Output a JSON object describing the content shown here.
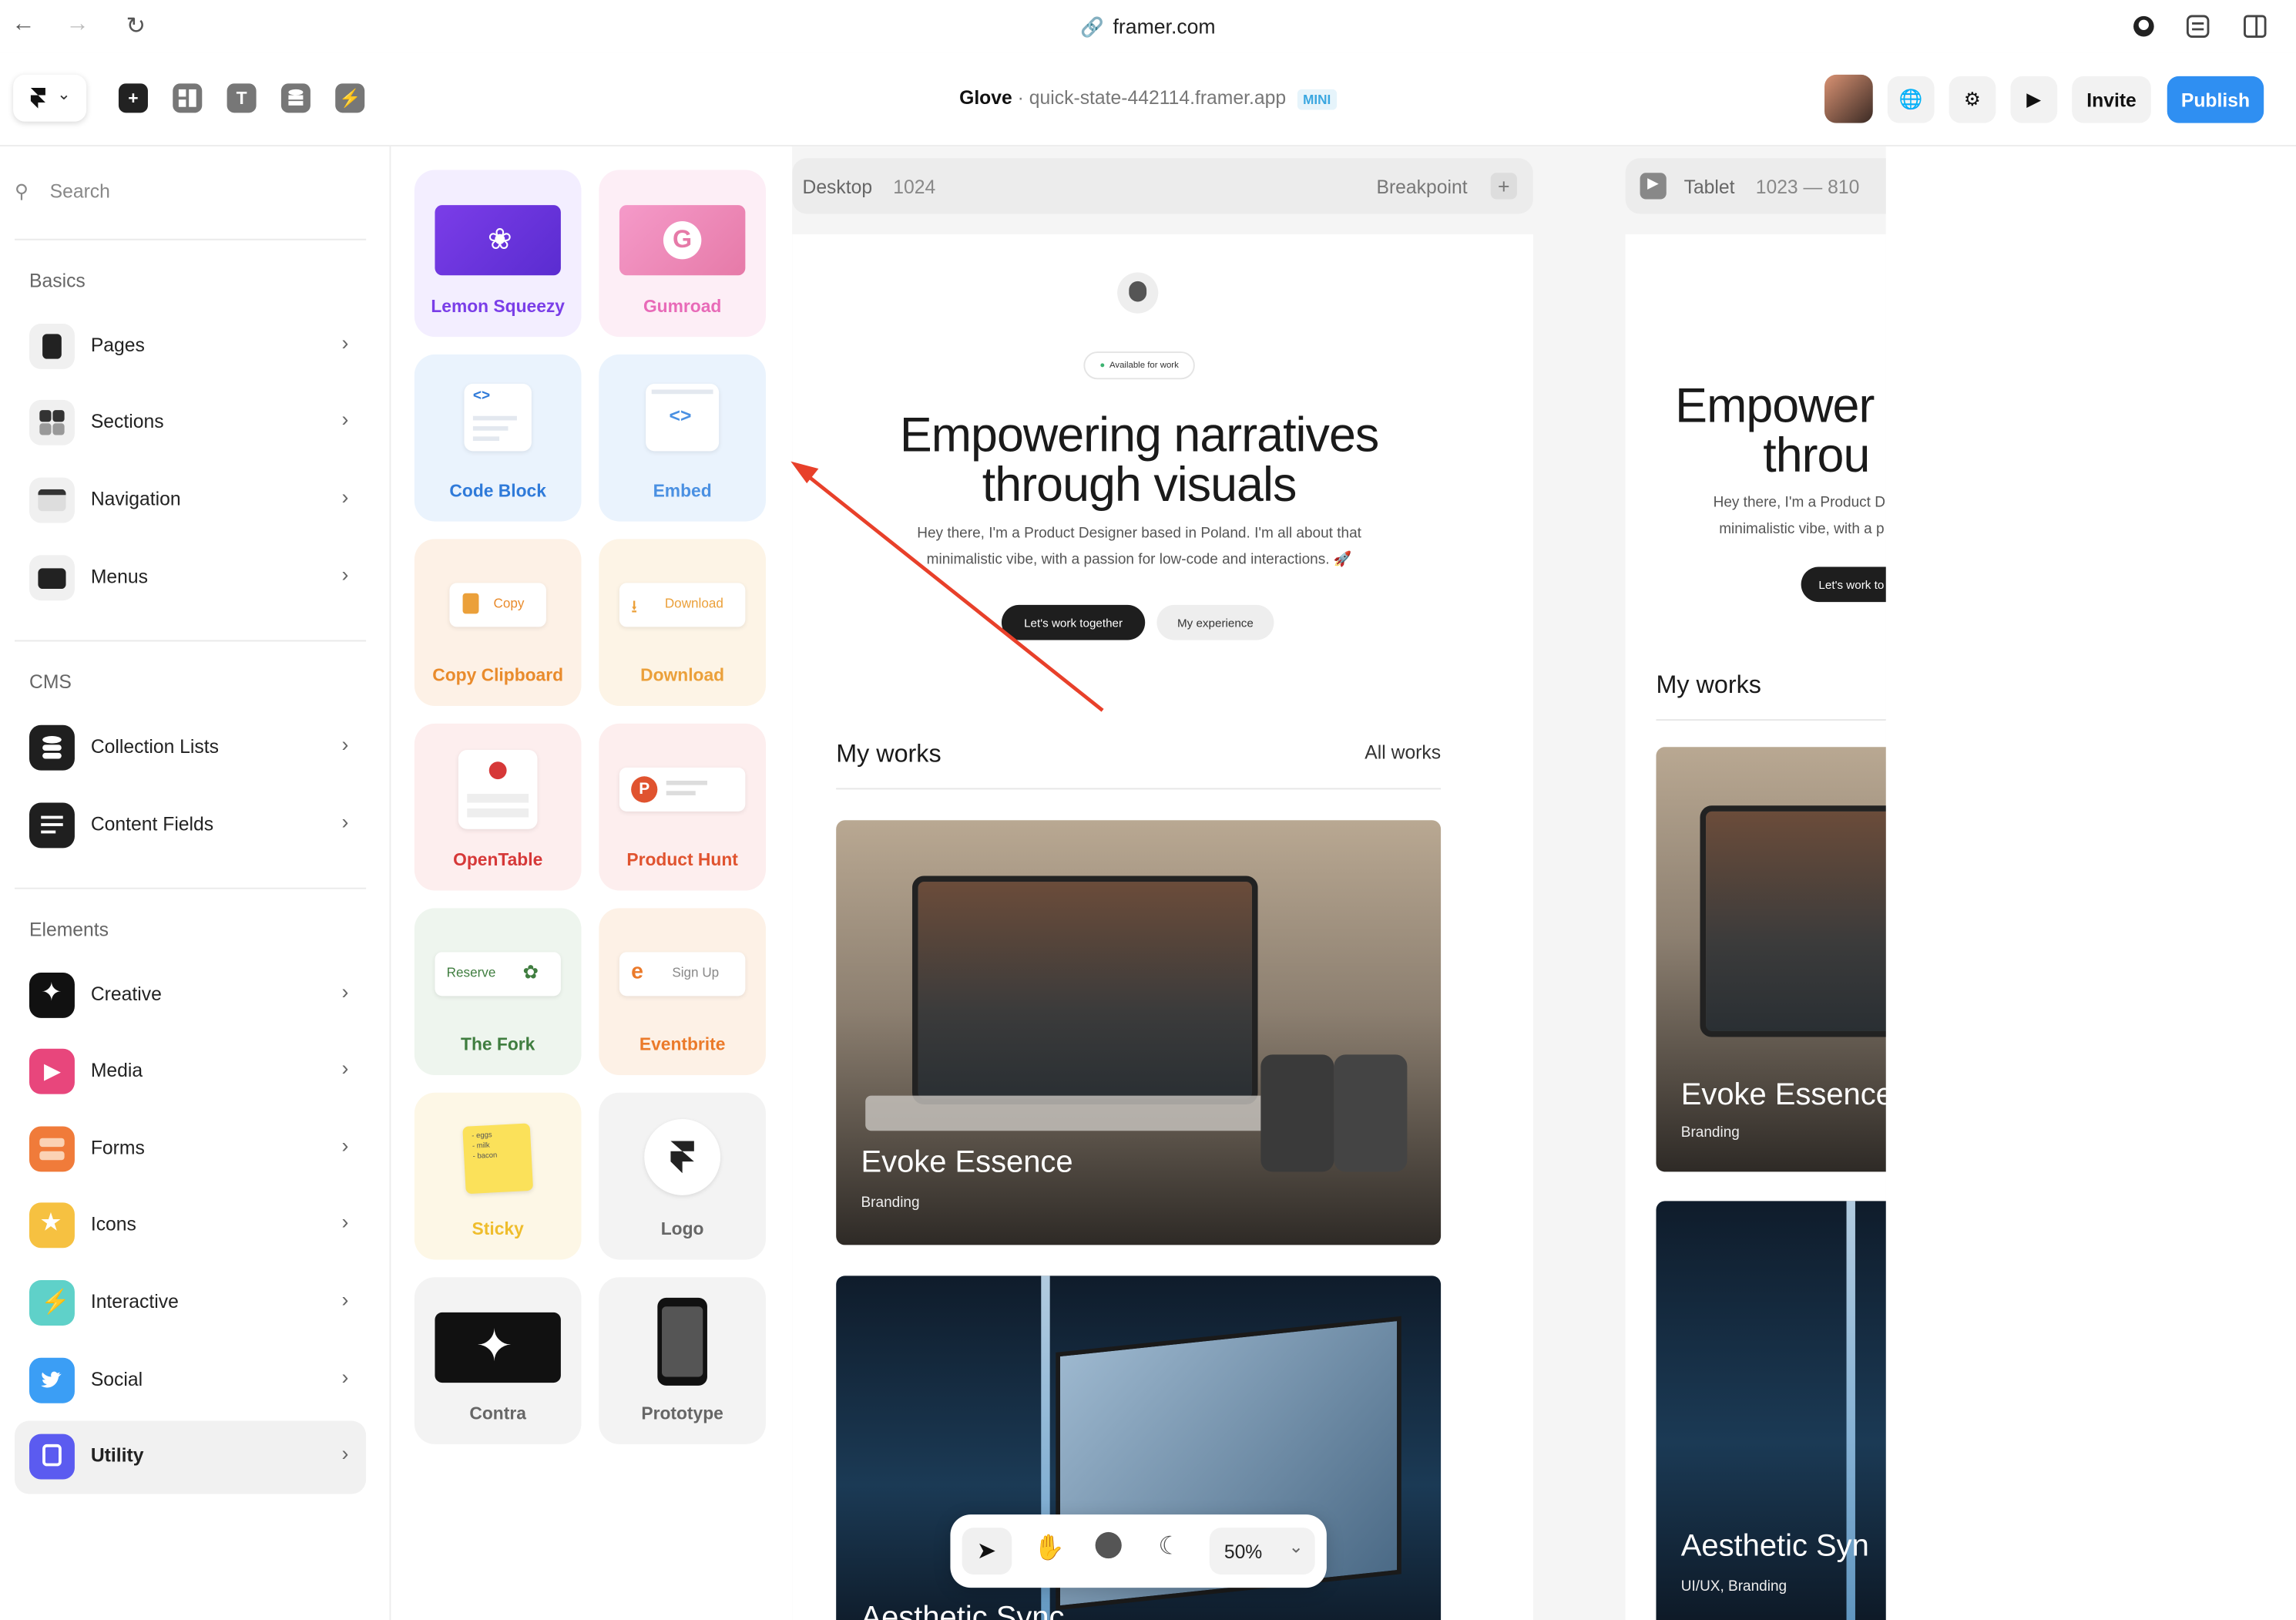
{
  "browser": {
    "url": "framer.com"
  },
  "header": {
    "project_name": "Glove",
    "separator": "·",
    "domain": "quick-state-442114.framer.app",
    "plan_badge": "MINI",
    "invite_label": "Invite",
    "publish_label": "Publish"
  },
  "sidebar": {
    "search_placeholder": "Search",
    "groups": [
      {
        "label": "Basics",
        "items": [
          {
            "label": "Pages",
            "icon": "pages-icon"
          },
          {
            "label": "Sections",
            "icon": "sections-icon"
          },
          {
            "label": "Navigation",
            "icon": "navigation-icon"
          },
          {
            "label": "Menus",
            "icon": "menus-icon"
          }
        ]
      },
      {
        "label": "CMS",
        "items": [
          {
            "label": "Collection Lists",
            "icon": "database-icon"
          },
          {
            "label": "Content Fields",
            "icon": "lines-icon"
          }
        ]
      },
      {
        "label": "Elements",
        "items": [
          {
            "label": "Creative",
            "icon": "sparkle-icon"
          },
          {
            "label": "Media",
            "icon": "play-icon"
          },
          {
            "label": "Forms",
            "icon": "form-icon"
          },
          {
            "label": "Icons",
            "icon": "star-icon"
          },
          {
            "label": "Interactive",
            "icon": "bolt-icon"
          },
          {
            "label": "Social",
            "icon": "twitter-icon"
          },
          {
            "label": "Utility",
            "icon": "utility-icon"
          }
        ]
      }
    ],
    "colors": {
      "pages": "#222222",
      "sections": "#444444",
      "navigation": "#333333",
      "menus": "#2a2a2a",
      "cms": "#1f1f1f",
      "creative": "#111111",
      "media": "#e8467c",
      "forms": "#f07b3a",
      "icons": "#f6c141",
      "interactive": "#5fd1c9",
      "social": "#3b9ef5",
      "utility": "#5b5bf0"
    }
  },
  "panel": {
    "cards": [
      {
        "label": "Lemon Squeezy",
        "bg": "#f3eeff",
        "color": "#7a3ee8"
      },
      {
        "label": "Gumroad",
        "bg": "#fdeef6",
        "color": "#e86ab8"
      },
      {
        "label": "Code Block",
        "bg": "#eaf3fd",
        "color": "#2f7ad9"
      },
      {
        "label": "Embed",
        "bg": "#eaf3fd",
        "color": "#4a90e2"
      },
      {
        "label": "Copy Clipboard",
        "bg": "#fdf1e6",
        "color": "#e98b2c",
        "thumb_text": "Copy"
      },
      {
        "label": "Download",
        "bg": "#fdf4e6",
        "color": "#eba03a",
        "thumb_text": "Download"
      },
      {
        "label": "OpenTable",
        "bg": "#fdeeee",
        "color": "#d63838"
      },
      {
        "label": "Product Hunt",
        "bg": "#fdeeee",
        "color": "#e0532f"
      },
      {
        "label": "The Fork",
        "bg": "#eef5ee",
        "color": "#3f7d3f",
        "thumb_text": "Reserve"
      },
      {
        "label": "Eventbrite",
        "bg": "#fdf1e6",
        "color": "#eb7a2a",
        "thumb_text": "Sign Up"
      },
      {
        "label": "Sticky",
        "bg": "#fdf7e6",
        "color": "#efbd2c",
        "thumb_text": "- eggs\n- milk\n- bacon"
      },
      {
        "label": "Logo",
        "bg": "#f3f3f3",
        "color": "#666666"
      },
      {
        "label": "Contra",
        "bg": "#f3f3f3",
        "color": "#666666"
      },
      {
        "label": "Prototype",
        "bg": "#f3f3f3",
        "color": "#666666"
      }
    ]
  },
  "canvas": {
    "desktop": {
      "label": "Desktop",
      "width": "1024",
      "breakpoint_label": "Breakpoint"
    },
    "tablet": {
      "label": "Tablet",
      "range": "1023 — 810"
    },
    "site": {
      "badge": "Available for work",
      "title_line1": "Empowering narratives",
      "title_line2": "through visuals",
      "subtitle_line1": "Hey there, I'm a Product Designer based in Poland. I'm all about that",
      "subtitle_line2": "minimalistic vibe, with a passion for low-code and interactions. 🚀",
      "cta_primary": "Let's work together",
      "cta_secondary": "My experience",
      "works_heading": "My works",
      "all_works": "All works",
      "works": [
        {
          "title": "Evoke Essence",
          "tag": "Branding"
        },
        {
          "title": "Aesthetic Sync",
          "tag": "UI/UX, Branding"
        }
      ]
    },
    "tablet_site": {
      "title_line1": "Empower",
      "title_line2": "throu",
      "subtitle_line1": "Hey there, I'm a Product D",
      "subtitle_line2": "minimalistic vibe, with a p",
      "cta_primary": "Let's work to",
      "works_heading": "My works",
      "work1_title": "Evoke Essence",
      "work1_tag": "Branding",
      "work2_title": "Aesthetic Syn",
      "work2_tag": "UI/UX, Branding"
    },
    "partial_caption": "Aesthetic Sync"
  },
  "bottom_toolbar": {
    "zoom": "50%"
  },
  "annotation_color": "#e8402a"
}
